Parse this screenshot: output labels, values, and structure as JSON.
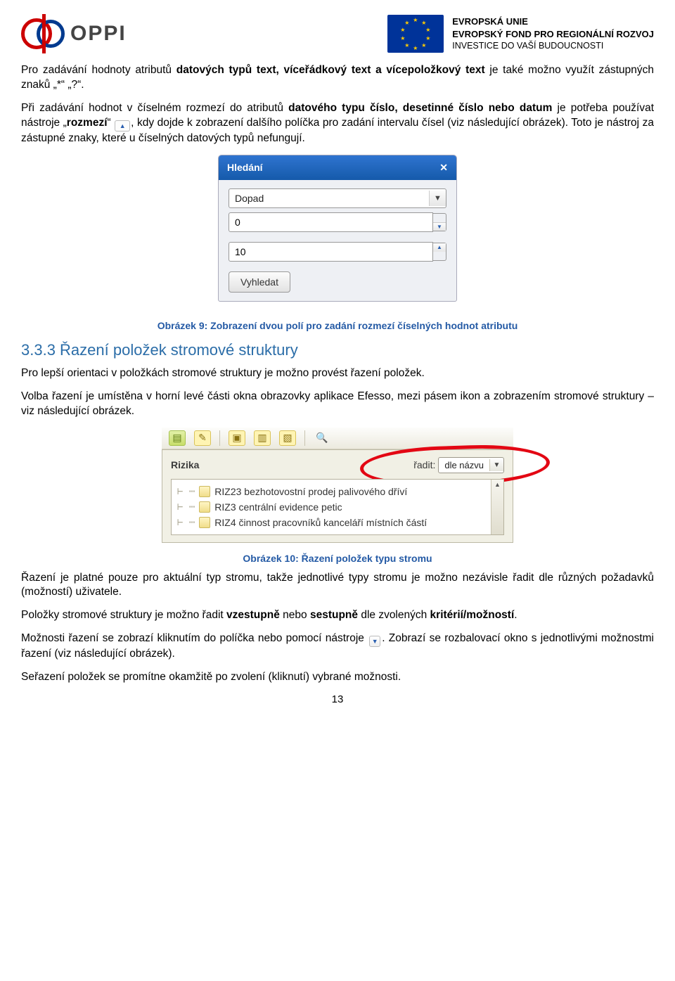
{
  "header": {
    "oppi_text": "OPPI",
    "eu_line1": "EVROPSKÁ UNIE",
    "eu_line2": "EVROPSKÝ FOND PRO REGIONÁLNÍ ROZVOJ",
    "eu_line3": "INVESTICE DO VAŠÍ BUDOUCNOSTI"
  },
  "p1_a": "Pro zadávání hodnoty atributů ",
  "p1_b": "datových typů text, víceřádkový text a vícepoložkový text",
  "p1_c": " je také možno využít zástupných znaků „*“ „?“.",
  "p2_a": "Při zadávání hodnot v číselném rozmezí do atributů ",
  "p2_b": "datového typu číslo, desetinné číslo nebo datum",
  "p2_c": " je potřeba používat nástroje „",
  "p2_d": "rozmezí",
  "p2_e": "“ ",
  "p2_f": ", kdy dojde k zobrazení dalšího políčka pro zadání intervalu čísel (viz následující obrázek). Toto je nástroj za zástupné znaky, které u číselných datových typů nefungují.",
  "panel1": {
    "title": "Hledání",
    "combo": "Dopad",
    "num1": "0",
    "num2": "10",
    "button": "Vyhledat"
  },
  "caption1": "Obrázek 9: Zobrazení dvou polí pro zadání rozmezí číselných hodnot atributu",
  "h3": "3.3.3 Řazení položek stromové struktury",
  "p3": "Pro lepší orientaci v položkách stromové struktury je možno provést řazení položek.",
  "p4": "Volba řazení je umístěna v horní levé části okna obrazovky aplikace Efesso, mezi pásem ikon a zobrazením stromové struktury – viz následující obrázek.",
  "panel2": {
    "section": "Rizika",
    "sort_label": "řadit:",
    "sort_value": "dle názvu",
    "items": [
      "RIZ23 bezhotovostní prodej palivového dříví",
      "RIZ3 centrální evidence petic",
      "RIZ4 činnost pracovníků kanceláří místních částí"
    ]
  },
  "caption2": "Obrázek 10: Řazení položek typu stromu",
  "p5": "Řazení je platné pouze pro aktuální typ stromu, takže jednotlivé typy stromu je možno nezávisle řadit dle různých požadavků (možností) uživatele.",
  "p6_a": "Položky stromové struktury je možno řadit ",
  "p6_b": "vzestupně",
  "p6_c": " nebo ",
  "p6_d": "sestupně",
  "p6_e": " dle zvolených ",
  "p6_f": "kritérií/možností",
  "p6_g": ".",
  "p7_a": "Možnosti řazení se zobrazí kliknutím do políčka nebo pomocí nástroje ",
  "p7_b": ". Zobrazí se rozbalovací okno s jednotlivými možnostmi řazení (viz následující obrázek).",
  "p8": "Seřazení položek se promítne okamžitě po zvolení (kliknutí) vybrané možnosti.",
  "page_number": "13"
}
